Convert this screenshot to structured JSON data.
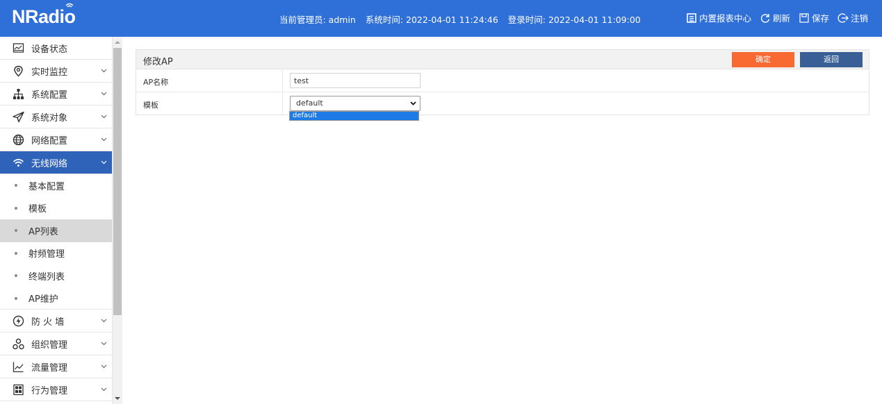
{
  "header": {
    "logo": "NRadio",
    "admin": "当前管理员: admin",
    "system_time": "系统时间: 2022-04-01 11:24:46",
    "login_time": "登录时间: 2022-04-01 11:09:00",
    "actions": {
      "report": "内置报表中心",
      "refresh": "刷新",
      "save": "保存",
      "logout": "注销"
    }
  },
  "sidebar": {
    "items": [
      {
        "label": "设备状态",
        "icon": "monitor-icon"
      },
      {
        "label": "实时监控",
        "icon": "location-pin-icon"
      },
      {
        "label": "系统配置",
        "icon": "sitemap-icon"
      },
      {
        "label": "系统对象",
        "icon": "send-icon"
      },
      {
        "label": "网络配置",
        "icon": "globe-icon"
      },
      {
        "label": "无线网络",
        "icon": "wifi-icon"
      }
    ],
    "subitems": [
      "基本配置",
      "模板",
      "AP列表",
      "射频管理",
      "终端列表",
      "AP维护"
    ],
    "items_after": [
      {
        "label": "防 火 墙",
        "icon": "firewall-icon"
      },
      {
        "label": "组织管理",
        "icon": "organization-icon"
      },
      {
        "label": "流量管理",
        "icon": "chart-line-icon"
      },
      {
        "label": "行为管理",
        "icon": "behavior-icon"
      }
    ]
  },
  "panel": {
    "title": "修改AP",
    "confirm_label": "确定",
    "back_label": "返回",
    "ap_name_label": "AP名称",
    "ap_name_value": "test",
    "template_label": "模板",
    "template_value": "default",
    "template_options": [
      "default"
    ]
  },
  "colors": {
    "header_bg": "#2f6fd8",
    "active_menu": "#2f62b9",
    "confirm_btn": "#f96a33",
    "back_btn": "#3a5f96",
    "dropdown_highlight": "#1e7be6"
  }
}
